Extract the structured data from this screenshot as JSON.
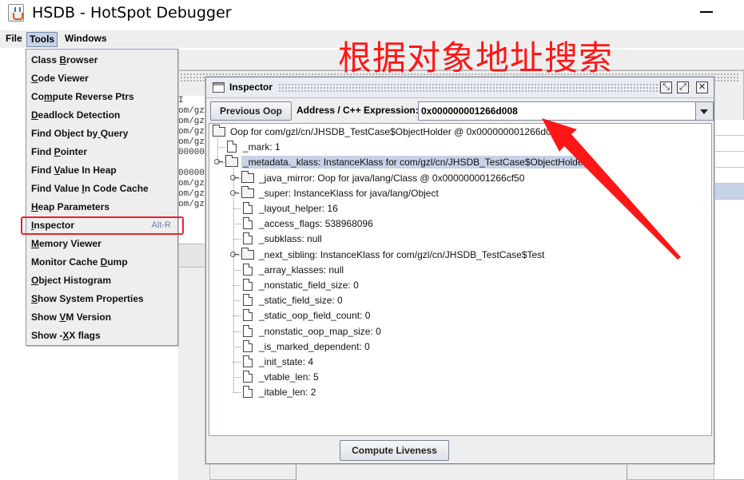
{
  "app": {
    "title": "HSDB - HotSpot Debugger"
  },
  "menubar": {
    "items": [
      "File",
      "Tools",
      "Windows"
    ],
    "active": "Tools"
  },
  "tools_menu": {
    "items": [
      {
        "label": "Class Browser",
        "shortcut": ""
      },
      {
        "label": "Code Viewer",
        "shortcut": ""
      },
      {
        "label": "Compute Reverse Ptrs",
        "shortcut": ""
      },
      {
        "label": "Deadlock Detection",
        "shortcut": ""
      },
      {
        "label": "Find Object by Query",
        "shortcut": ""
      },
      {
        "label": "Find Pointer",
        "shortcut": ""
      },
      {
        "label": "Find Value In Heap",
        "shortcut": ""
      },
      {
        "label": "Find Value In Code Cache",
        "shortcut": ""
      },
      {
        "label": "Heap Parameters",
        "shortcut": ""
      },
      {
        "label": "Inspector",
        "shortcut": "Alt-R"
      },
      {
        "label": "Memory Viewer",
        "shortcut": ""
      },
      {
        "label": "Monitor Cache Dump",
        "shortcut": ""
      },
      {
        "label": "Object Histogram",
        "shortcut": ""
      },
      {
        "label": "Show System Properties",
        "shortcut": ""
      },
      {
        "label": "Show VM Version",
        "shortcut": ""
      },
      {
        "label": "Show -XX flags",
        "shortcut": ""
      }
    ],
    "highlighted": "Inspector"
  },
  "background_text": {
    "lines": [
      "I",
      "om/gz",
      "om/gz",
      "om/gz",
      "om/gz",
      "00000",
      "",
      "00000",
      "om/gz",
      "om/gz",
      "om/gz"
    ]
  },
  "inspector": {
    "title": "Inspector",
    "previous_button": "Previous Oop",
    "address_label": "Address / C++ Expression:",
    "address_value": "0x000000001266d008",
    "compute_button": "Compute Liveness",
    "tree": [
      {
        "label": "Oop for com/gzl/cn/JHSDB_TestCase$ObjectHolder @ 0x000000001266d008",
        "icon": "folder",
        "level": 0,
        "expandable": false,
        "selected": false
      },
      {
        "label": "_mark: 1",
        "icon": "document",
        "level": 1,
        "expandable": false,
        "selected": false
      },
      {
        "label": "_metadata._klass: InstanceKlass for com/gzl/cn/JHSDB_TestCase$ObjectHolder",
        "icon": "folder",
        "level": 1,
        "expandable": true,
        "selected": true
      },
      {
        "label": "_java_mirror: Oop for java/lang/Class @ 0x000000001266cf50",
        "icon": "folder",
        "level": 2,
        "expandable": true,
        "selected": false
      },
      {
        "label": "_super: InstanceKlass for java/lang/Object",
        "icon": "folder",
        "level": 2,
        "expandable": true,
        "selected": false
      },
      {
        "label": "_layout_helper: 16",
        "icon": "document",
        "level": 2,
        "expandable": false,
        "selected": false
      },
      {
        "label": "_access_flags: 538968096",
        "icon": "document",
        "level": 2,
        "expandable": false,
        "selected": false
      },
      {
        "label": "_subklass: null",
        "icon": "document",
        "level": 2,
        "expandable": false,
        "selected": false
      },
      {
        "label": "_next_sibling: InstanceKlass for com/gzl/cn/JHSDB_TestCase$Test",
        "icon": "folder",
        "level": 2,
        "expandable": true,
        "selected": false
      },
      {
        "label": "_array_klasses: null",
        "icon": "document",
        "level": 2,
        "expandable": false,
        "selected": false
      },
      {
        "label": "_nonstatic_field_size: 0",
        "icon": "document",
        "level": 2,
        "expandable": false,
        "selected": false
      },
      {
        "label": "_static_field_size: 0",
        "icon": "document",
        "level": 2,
        "expandable": false,
        "selected": false
      },
      {
        "label": "_static_oop_field_count: 0",
        "icon": "document",
        "level": 2,
        "expandable": false,
        "selected": false
      },
      {
        "label": "_nonstatic_oop_map_size: 0",
        "icon": "document",
        "level": 2,
        "expandable": false,
        "selected": false
      },
      {
        "label": "_is_marked_dependent: 0",
        "icon": "document",
        "level": 2,
        "expandable": false,
        "selected": false
      },
      {
        "label": "_init_state: 4",
        "icon": "document",
        "level": 2,
        "expandable": false,
        "selected": false
      },
      {
        "label": "_vtable_len: 5",
        "icon": "document",
        "level": 2,
        "expandable": false,
        "selected": false
      },
      {
        "label": "_itable_len: 2",
        "icon": "document",
        "level": 2,
        "expandable": false,
        "selected": false
      }
    ]
  },
  "annotation": {
    "text": "根据对象地址搜索",
    "color": "#ff1616"
  },
  "colors": {
    "selection": "#c7d2e6",
    "highlight_border": "#e8202a"
  }
}
